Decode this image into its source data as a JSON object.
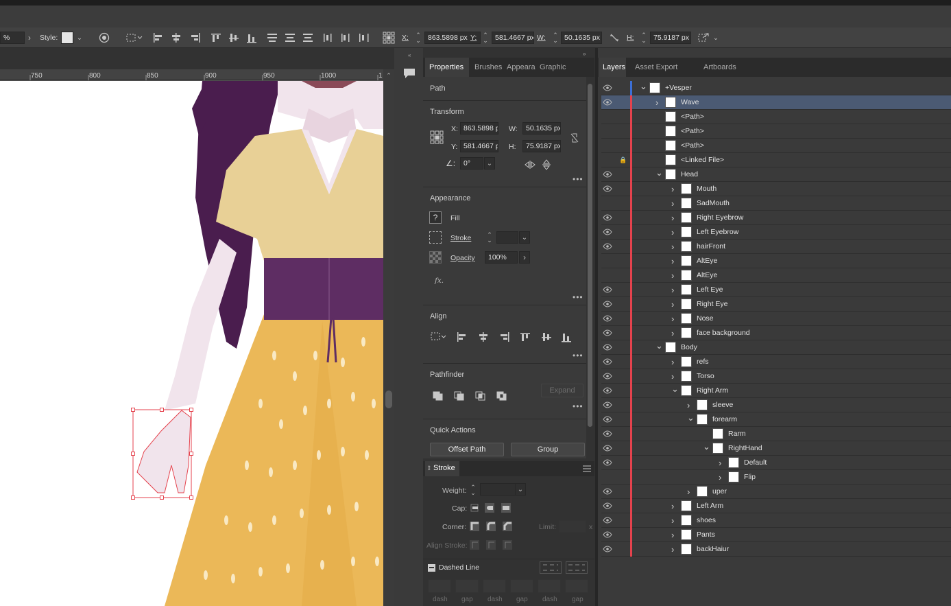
{
  "control_bar": {
    "zoom_value": "%",
    "style_label": "Style:",
    "x_label": "X:",
    "x_value": "863.5898 px",
    "y_label": "Y:",
    "y_value": "581.4667 px",
    "w_label": "W:",
    "w_value": "50.1635 px",
    "h_label": "H:",
    "h_value": "75.9187 px"
  },
  "ruler": {
    "ticks": [
      "750",
      "800",
      "850",
      "900",
      "950",
      "1000",
      "1"
    ]
  },
  "properties_panel": {
    "tabs": [
      "Properties",
      "Brushes",
      "Appeara",
      "Graphic"
    ],
    "object_type": "Path",
    "transform": {
      "title": "Transform",
      "x_label": "X:",
      "x_value": "863.5898 p",
      "y_label": "Y:",
      "y_value": "581.4667 p",
      "w_label": "W:",
      "w_value": "50.1635 px",
      "h_label": "H:",
      "h_value": "75.9187 px",
      "angle_value": "0°"
    },
    "appearance": {
      "title": "Appearance",
      "fill_label": "Fill",
      "fill_icon": "?",
      "stroke_label": "Stroke",
      "opacity_label": "Opacity",
      "opacity_value": "100%",
      "fx_label": "fx."
    },
    "align": {
      "title": "Align"
    },
    "pathfinder": {
      "title": "Pathfinder",
      "expand_label": "Expand"
    },
    "quick_actions": {
      "title": "Quick Actions",
      "offset_path_label": "Offset Path",
      "group_label": "Group"
    }
  },
  "stroke_panel": {
    "title": "Stroke",
    "weight_label": "Weight:",
    "cap_label": "Cap:",
    "corner_label": "Corner:",
    "limit_label": "Limit:",
    "limit_suffix": "x",
    "align_stroke_label": "Align Stroke:",
    "dashed_line_label": "Dashed Line",
    "dash_labels": [
      "dash",
      "gap",
      "dash",
      "gap",
      "dash",
      "gap"
    ]
  },
  "layers_panel": {
    "tabs": [
      "Layers",
      "Asset Export",
      "Artboards"
    ],
    "rows": [
      {
        "name": "+Vesper",
        "indent": 0,
        "chev": "v",
        "eye": true,
        "lock": false,
        "selected": false
      },
      {
        "name": "Wave",
        "indent": 1,
        "chev": ">",
        "eye": true,
        "lock": false,
        "selected": true
      },
      {
        "name": "<Path>",
        "indent": 1,
        "chev": "",
        "eye": false,
        "lock": false,
        "selected": false
      },
      {
        "name": "<Path>",
        "indent": 1,
        "chev": "",
        "eye": false,
        "lock": false,
        "selected": false
      },
      {
        "name": "<Path>",
        "indent": 1,
        "chev": "",
        "eye": false,
        "lock": false,
        "selected": false
      },
      {
        "name": "<Linked File>",
        "indent": 1,
        "chev": "",
        "eye": false,
        "lock": true,
        "selected": false
      },
      {
        "name": "Head",
        "indent": 1,
        "chev": "v",
        "eye": true,
        "lock": false,
        "selected": false
      },
      {
        "name": "Mouth",
        "indent": 2,
        "chev": ">",
        "eye": true,
        "lock": false,
        "selected": false
      },
      {
        "name": "SadMouth",
        "indent": 2,
        "chev": ">",
        "eye": false,
        "lock": false,
        "selected": false
      },
      {
        "name": "Right Eyebrow",
        "indent": 2,
        "chev": ">",
        "eye": true,
        "lock": false,
        "selected": false
      },
      {
        "name": "Left Eyebrow",
        "indent": 2,
        "chev": ">",
        "eye": true,
        "lock": false,
        "selected": false
      },
      {
        "name": "hairFront",
        "indent": 2,
        "chev": ">",
        "eye": true,
        "lock": false,
        "selected": false
      },
      {
        "name": "AltEye",
        "indent": 2,
        "chev": ">",
        "eye": false,
        "lock": false,
        "selected": false
      },
      {
        "name": "AltEye",
        "indent": 2,
        "chev": ">",
        "eye": false,
        "lock": false,
        "selected": false
      },
      {
        "name": "Left Eye",
        "indent": 2,
        "chev": ">",
        "eye": true,
        "lock": false,
        "selected": false
      },
      {
        "name": "Right Eye",
        "indent": 2,
        "chev": ">",
        "eye": true,
        "lock": false,
        "selected": false
      },
      {
        "name": "Nose",
        "indent": 2,
        "chev": ">",
        "eye": true,
        "lock": false,
        "selected": false
      },
      {
        "name": "face background",
        "indent": 2,
        "chev": ">",
        "eye": true,
        "lock": false,
        "selected": false
      },
      {
        "name": "Body",
        "indent": 1,
        "chev": "v",
        "eye": true,
        "lock": false,
        "selected": false
      },
      {
        "name": "refs",
        "indent": 2,
        "chev": ">",
        "eye": true,
        "lock": false,
        "selected": false
      },
      {
        "name": "Torso",
        "indent": 2,
        "chev": ">",
        "eye": true,
        "lock": false,
        "selected": false
      },
      {
        "name": "Right Arm",
        "indent": 2,
        "chev": "v",
        "eye": true,
        "lock": false,
        "selected": false
      },
      {
        "name": "sleeve",
        "indent": 3,
        "chev": ">",
        "eye": true,
        "lock": false,
        "selected": false
      },
      {
        "name": "forearm",
        "indent": 3,
        "chev": "v",
        "eye": true,
        "lock": false,
        "selected": false
      },
      {
        "name": "Rarm",
        "indent": 4,
        "chev": "",
        "eye": true,
        "lock": false,
        "selected": false
      },
      {
        "name": "RightHand",
        "indent": 4,
        "chev": "v",
        "eye": true,
        "lock": false,
        "selected": false
      },
      {
        "name": "Default",
        "indent": 5,
        "chev": ">",
        "eye": true,
        "lock": false,
        "selected": false
      },
      {
        "name": "Flip",
        "indent": 5,
        "chev": ">",
        "eye": false,
        "lock": false,
        "selected": false
      },
      {
        "name": "uper",
        "indent": 3,
        "chev": ">",
        "eye": true,
        "lock": false,
        "selected": false
      },
      {
        "name": "Left Arm",
        "indent": 2,
        "chev": ">",
        "eye": true,
        "lock": false,
        "selected": false
      },
      {
        "name": "shoes",
        "indent": 2,
        "chev": ">",
        "eye": true,
        "lock": false,
        "selected": false
      },
      {
        "name": "Pants",
        "indent": 2,
        "chev": ">",
        "eye": true,
        "lock": false,
        "selected": false
      },
      {
        "name": "backHaiur",
        "indent": 2,
        "chev": ">",
        "eye": true,
        "lock": false,
        "selected": false
      }
    ]
  },
  "colors": {
    "hair": "#4a1d4e",
    "blouse": "#e8d096",
    "corset": "#5e2d63",
    "skirt": "#ebb858",
    "skin": "#f1e4ec",
    "selection": "#e5424d",
    "layer_bar": "#e5424d",
    "selected_row": "#4b5a73"
  }
}
